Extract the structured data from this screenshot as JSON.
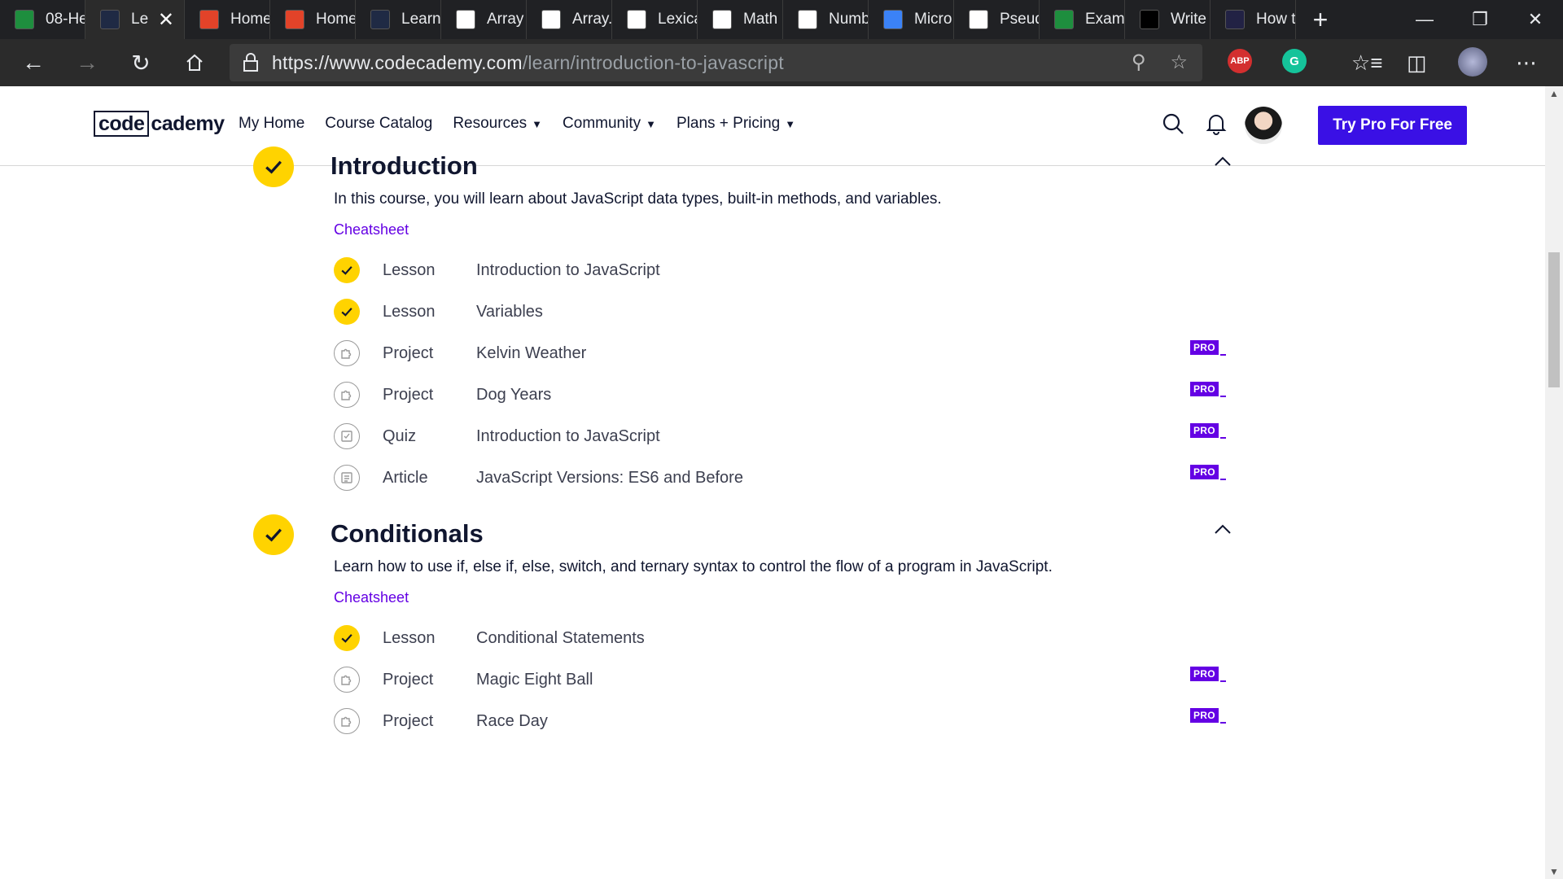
{
  "browser": {
    "tabs": [
      {
        "label": "08-He",
        "icon": "classroom-icon",
        "color": "#1e8e3e"
      },
      {
        "label": "Le",
        "icon": "codecademy-tab-icon",
        "color": "#1f2a44",
        "active": true
      },
      {
        "label": "Home",
        "icon": "gitlab-icon",
        "color": "#e24329"
      },
      {
        "label": "Home",
        "icon": "gitlab-icon",
        "color": "#e24329"
      },
      {
        "label": "Learn",
        "icon": "codecademy-tab-icon",
        "color": "#1f2a44"
      },
      {
        "label": "Array",
        "icon": "pluralsight-icon",
        "color": "#ffffff"
      },
      {
        "label": "Array.",
        "icon": "pluralsight-icon",
        "color": "#ffffff"
      },
      {
        "label": "Lexica",
        "icon": "pluralsight-icon",
        "color": "#ffffff"
      },
      {
        "label": "Math",
        "icon": "pluralsight-icon",
        "color": "#ffffff"
      },
      {
        "label": "Numb",
        "icon": "pluralsight-icon",
        "color": "#ffffff"
      },
      {
        "label": "Micro",
        "icon": "microsoft-icon",
        "color": "#3b82f6"
      },
      {
        "label": "Pseud",
        "icon": "document-icon",
        "color": "#ffffff"
      },
      {
        "label": "Examp",
        "icon": "spartan-icon",
        "color": "#1e8e3e"
      },
      {
        "label": "Write",
        "icon": "bold-b-icon",
        "color": "#000000"
      },
      {
        "label": "How t",
        "icon": "dark-icon",
        "color": "#222244"
      }
    ],
    "url_domain": "https://www.codecademy.com",
    "url_path": "/learn/introduction-to-javascript",
    "extensions": {
      "abp": "ABP",
      "grammarly": "G"
    }
  },
  "nav": {
    "logo_code": "code",
    "logo_rest": "cademy",
    "links": [
      {
        "label": "My Home",
        "caret": false
      },
      {
        "label": "Course Catalog",
        "caret": false
      },
      {
        "label": "Resources",
        "caret": true
      },
      {
        "label": "Community",
        "caret": true
      },
      {
        "label": "Plans + Pricing",
        "caret": true
      }
    ],
    "cta": "Try Pro For Free",
    "caret_glyph": "▼"
  },
  "sections": [
    {
      "title": "Introduction",
      "description": "In this course, you will learn about JavaScript data types, built-in methods, and variables.",
      "cheatsheet": "Cheatsheet",
      "items": [
        {
          "type": "Lesson",
          "name": "Introduction to JavaScript",
          "done": true,
          "pro": false
        },
        {
          "type": "Lesson",
          "name": "Variables",
          "done": true,
          "pro": false
        },
        {
          "type": "Project",
          "name": "Kelvin Weather",
          "done": false,
          "pro": true
        },
        {
          "type": "Project",
          "name": "Dog Years",
          "done": false,
          "pro": true
        },
        {
          "type": "Quiz",
          "name": "Introduction to JavaScript",
          "done": false,
          "pro": true
        },
        {
          "type": "Article",
          "name": "JavaScript Versions: ES6 and Before",
          "done": false,
          "pro": true
        }
      ]
    },
    {
      "title": "Conditionals",
      "description": "Learn how to use if, else if, else, switch, and ternary syntax to control the flow of a program in JavaScript.",
      "cheatsheet": "Cheatsheet",
      "items": [
        {
          "type": "Lesson",
          "name": "Conditional Statements",
          "done": true,
          "pro": false
        },
        {
          "type": "Project",
          "name": "Magic Eight Ball",
          "done": false,
          "pro": true
        },
        {
          "type": "Project",
          "name": "Race Day",
          "done": false,
          "pro": true
        }
      ]
    }
  ],
  "pro_badge": "PRO",
  "colors": {
    "check": "#ffd300",
    "pro": "#6400e4",
    "cta": "#3a10e5",
    "link": "#6400e4"
  }
}
